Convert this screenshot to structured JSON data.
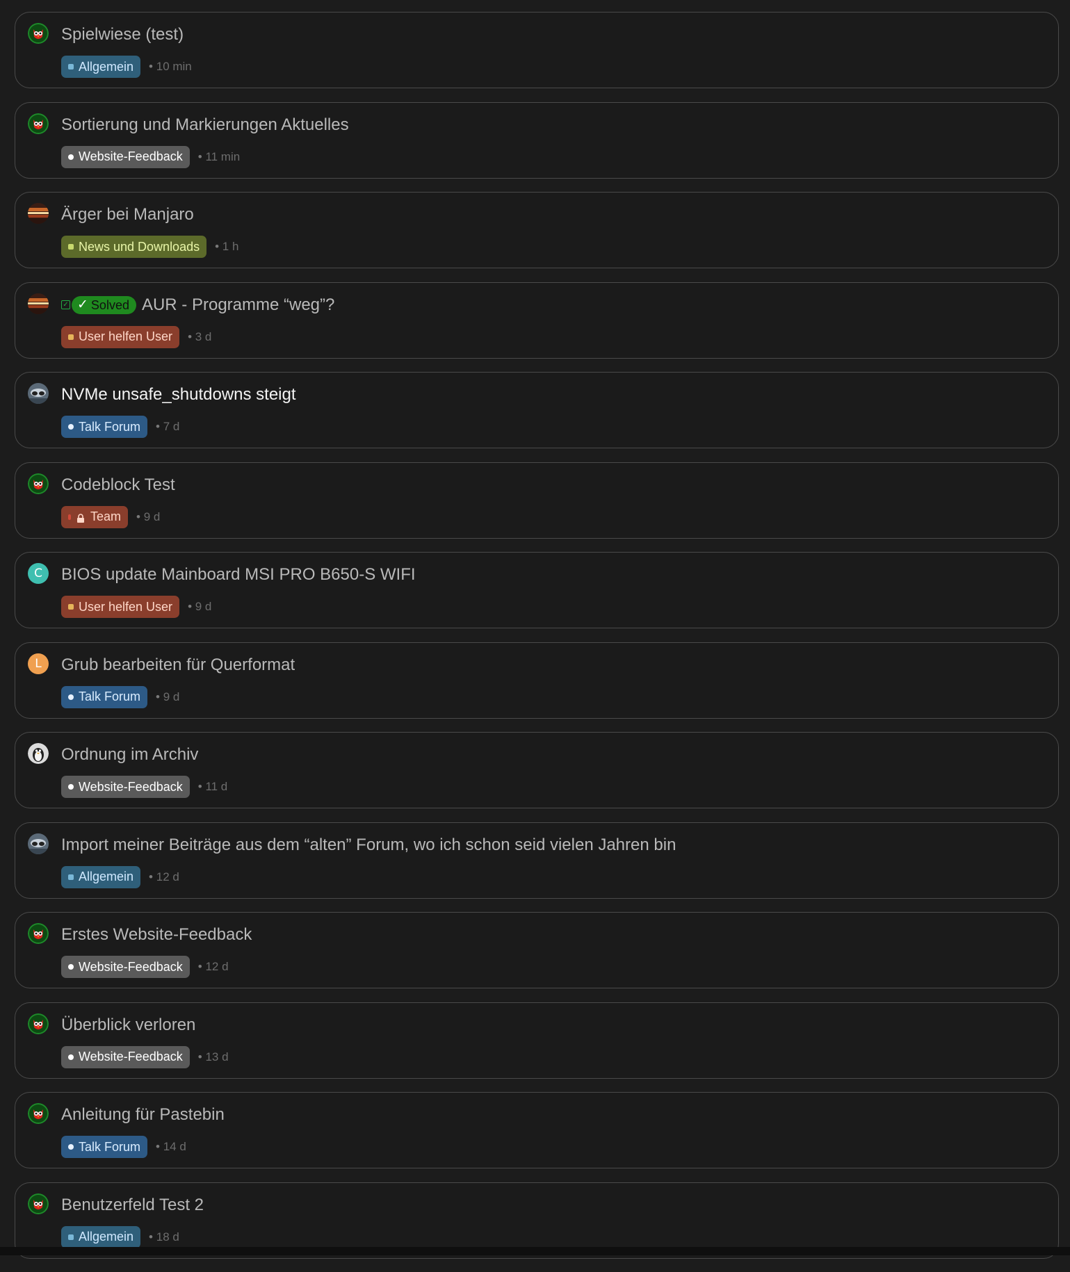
{
  "colors": {
    "background": "#1c1c1c",
    "card_border": "#4a4a4a",
    "solved_green": "#1f8a1f"
  },
  "topics": [
    {
      "title": "Spielwiese (test)",
      "avatar": "owl-avatar",
      "category": "Allgemein",
      "category_style": "allgemein",
      "age": "10 min"
    },
    {
      "title": "Sortierung und Markierungen Aktuelles",
      "avatar": "owl-avatar",
      "category": "Website-Feedback",
      "category_style": "website",
      "age": "11 min"
    },
    {
      "title": "Ärger bei Manjaro",
      "avatar": "sunset-avatar",
      "category": "News und Downloads",
      "category_style": "news",
      "age": "1 h"
    },
    {
      "title": "AUR - Programme “weg”?",
      "avatar": "sunset-avatar",
      "solved": "Solved",
      "category": "User helfen User",
      "category_style": "user",
      "age": "3 d"
    },
    {
      "title": "NVMe unsafe_shutdowns steigt",
      "avatar": "photo-avatar",
      "bright": true,
      "category": "Talk Forum",
      "category_style": "talk",
      "age": "7 d"
    },
    {
      "title": "Codeblock Test",
      "avatar": "owl-avatar",
      "category": "Team",
      "category_style": "team",
      "age": "9 d"
    },
    {
      "title": "BIOS update Mainboard MSI PRO B650-S WIFI",
      "avatar": "letter-avatar",
      "avatar_letter": "C",
      "avatar_color": "#3fbfb0",
      "category": "User helfen User",
      "category_style": "user",
      "age": "9 d"
    },
    {
      "title": "Grub bearbeiten für Querformat",
      "avatar": "letter-avatar",
      "avatar_letter": "L",
      "avatar_color": "#f0a050",
      "category": "Talk Forum",
      "category_style": "talk",
      "age": "9 d"
    },
    {
      "title": "Ordnung im Archiv",
      "avatar": "tux-avatar",
      "category": "Website-Feedback",
      "category_style": "website",
      "age": "11 d"
    },
    {
      "title": "Import meiner Beiträge aus dem “alten” Forum, wo ich schon seid vielen Jahren bin",
      "avatar": "photo-avatar",
      "category": "Allgemein",
      "category_style": "allgemein",
      "age": "12 d"
    },
    {
      "title": "Erstes Website-Feedback",
      "avatar": "owl-avatar",
      "category": "Website-Feedback",
      "category_style": "website",
      "age": "12 d"
    },
    {
      "title": "Überblick verloren",
      "avatar": "owl-avatar",
      "category": "Website-Feedback",
      "category_style": "website",
      "age": "13 d"
    },
    {
      "title": "Anleitung für Pastebin",
      "avatar": "owl-avatar",
      "category": "Talk Forum",
      "category_style": "talk",
      "age": "14 d"
    },
    {
      "title": "Benutzerfeld Test 2",
      "avatar": "owl-avatar",
      "category": "Allgemein",
      "category_style": "allgemein",
      "age": "18 d"
    }
  ]
}
